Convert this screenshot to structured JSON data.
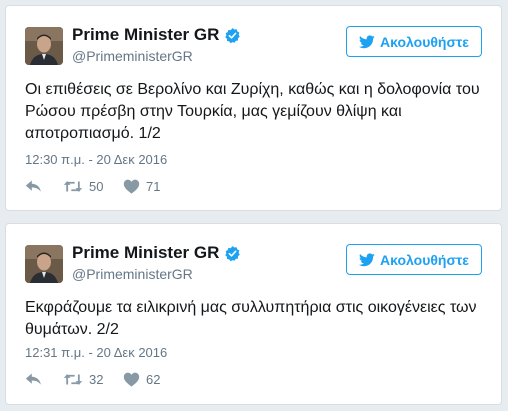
{
  "colors": {
    "accent": "#1da1f2",
    "muted": "#657786",
    "icon": "#8899a6",
    "background": "#e6ecf0"
  },
  "tweets": [
    {
      "display_name": "Prime Minister GR",
      "handle": "@PrimeministerGR",
      "follow_label": "Ακολουθήστε",
      "text": "Οι επιθέσεις σε Βερολίνο και Ζυρίχη, καθώς και η δολοφονία του Ρώσου πρέσβη στην Τουρκία, μας γεμίζουν θλίψη και αποτροπιασμό. 1/2",
      "timestamp": "12:30 π.μ. - 20 Δεκ 2016",
      "retweets": "50",
      "likes": "71",
      "icons": [
        "avatar",
        "verified-badge-icon",
        "twitter-bird-icon",
        "reply-icon",
        "retweet-icon",
        "heart-icon"
      ]
    },
    {
      "display_name": "Prime Minister GR",
      "handle": "@PrimeministerGR",
      "follow_label": "Ακολουθήστε",
      "text": "Εκφράζουμε τα ειλικρινή μας συλλυπητήρια στις οικογένειες των θυμάτων. 2/2",
      "timestamp": "12:31 π.μ. - 20 Δεκ 2016",
      "retweets": "32",
      "likes": "62",
      "icons": [
        "avatar",
        "verified-badge-icon",
        "twitter-bird-icon",
        "reply-icon",
        "retweet-icon",
        "heart-icon"
      ]
    }
  ]
}
